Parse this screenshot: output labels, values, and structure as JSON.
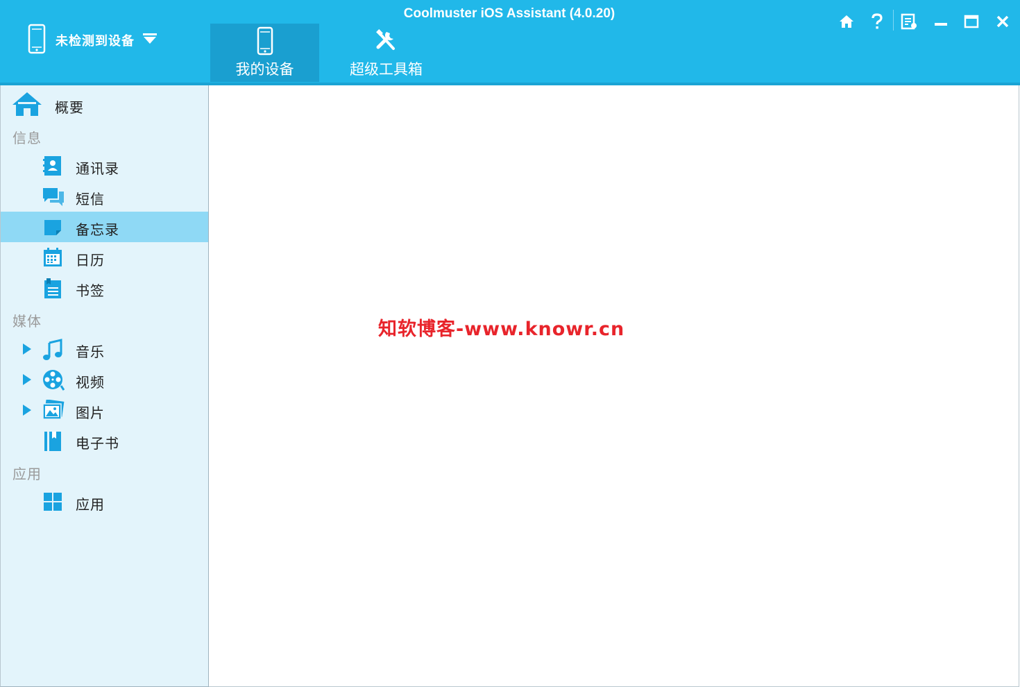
{
  "app": {
    "title": "Coolmuster iOS Assistant (4.0.20)"
  },
  "device": {
    "label": "未检测到设备"
  },
  "tabs": [
    {
      "label": "我的设备",
      "active": true
    },
    {
      "label": "超级工具箱",
      "active": false
    }
  ],
  "window_controls": [
    "home-icon",
    "help-icon",
    "register-icon",
    "minimize-icon",
    "maximize-icon",
    "close-icon"
  ],
  "sidebar": {
    "overview": {
      "label": "概要"
    },
    "sections": [
      {
        "title": "信息",
        "items": [
          {
            "label": "通讯录",
            "icon": "contacts-icon"
          },
          {
            "label": "短信",
            "icon": "messages-icon"
          },
          {
            "label": "备忘录",
            "icon": "notes-icon",
            "selected": true
          },
          {
            "label": "日历",
            "icon": "calendar-icon"
          },
          {
            "label": "书签",
            "icon": "bookmarks-icon"
          }
        ]
      },
      {
        "title": "媒体",
        "items": [
          {
            "label": "音乐",
            "icon": "music-icon",
            "expandable": true
          },
          {
            "label": "视频",
            "icon": "video-icon",
            "expandable": true
          },
          {
            "label": "图片",
            "icon": "photos-icon",
            "expandable": true
          },
          {
            "label": "电子书",
            "icon": "ebook-icon"
          }
        ]
      },
      {
        "title": "应用",
        "items": [
          {
            "label": "应用",
            "icon": "apps-icon"
          }
        ]
      }
    ]
  },
  "watermark": "知软博客-www.knowr.cn",
  "colors": {
    "header": "#21b8e9",
    "active_tab": "#1a9fd0",
    "sidebar_bg": "#e3f4fb",
    "selected": "#8fd9f5",
    "icon": "#1aa3e0"
  }
}
